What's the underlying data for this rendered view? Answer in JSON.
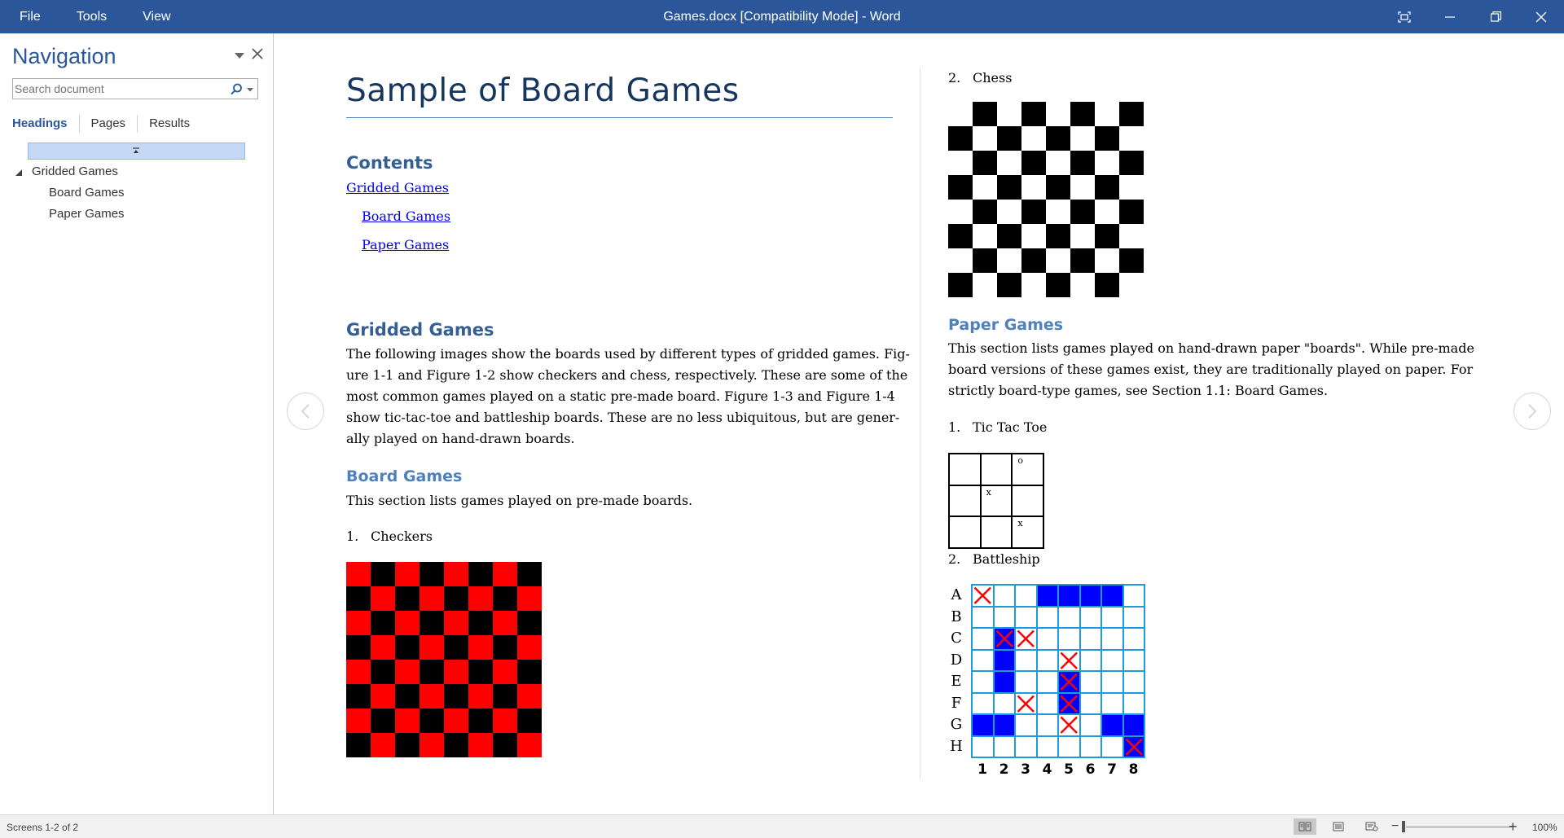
{
  "window": {
    "title": "Games.docx [Compatibility Mode] - Word",
    "menu": [
      "File",
      "Tools",
      "View"
    ]
  },
  "navigation": {
    "title": "Navigation",
    "search_placeholder": "Search document",
    "tabs": [
      "Headings",
      "Pages",
      "Results"
    ],
    "active_tab": "Headings",
    "tree": [
      {
        "label": "Gridded Games",
        "level": 1,
        "expanded": true
      },
      {
        "label": "Board Games",
        "level": 2
      },
      {
        "label": "Paper Games",
        "level": 2
      }
    ]
  },
  "document": {
    "title": "Sample of Board Games",
    "contents_heading": "Contents",
    "toc": [
      "Gridded Games",
      "Board Games",
      "Paper Games"
    ],
    "gridded_heading": "Gridded Games",
    "gridded_para": [
      "The following images show the boards used by different types of gridded games. Fig-",
      "ure 1-1 and Figure 1-2 show checkers and chess, respectively. These are some of the",
      "most common games played on a static pre-made board. Figure 1-3 and Figure 1-4",
      "show tic-tac-toe and battleship boards. These are no less ubiquitous, but are gener-",
      "ally played on hand-drawn boards."
    ],
    "board_heading": "Board Games",
    "board_para": "This section lists games played on pre-made boards.",
    "board_list": [
      {
        "num": "1.",
        "label": "Checkers"
      },
      {
        "num": "2.",
        "label": "Chess"
      }
    ],
    "paper_heading": "Paper Games",
    "paper_para": [
      "This section lists games played on hand-drawn paper \"boards\". While pre-made",
      "board versions of these games exist, they are traditionally played on paper. For",
      "strictly board-type games, see Section 1.1: Board Games."
    ],
    "paper_list": [
      {
        "num": "1.",
        "label": "Tic Tac Toe"
      },
      {
        "num": "2.",
        "label": "Battleship"
      }
    ],
    "checkers_colors": {
      "a": "#ff0000",
      "b": "#000000"
    },
    "chess_colors": {
      "a": "#ffffff",
      "b": "#000000"
    },
    "tictactoe": [
      "",
      "",
      "o",
      "",
      "x",
      "",
      "",
      "",
      "x"
    ],
    "battleship": {
      "rows": [
        "A",
        "B",
        "C",
        "D",
        "E",
        "F",
        "G",
        "H"
      ],
      "cols": [
        "1",
        "2",
        "3",
        "4",
        "5",
        "6",
        "7",
        "8"
      ],
      "ship_color": "#0000ff",
      "hit_color": "#ff0000",
      "ships": [
        "A4",
        "A5",
        "A6",
        "A7",
        "C2",
        "D2",
        "E2",
        "E5",
        "F5",
        "G1",
        "G2",
        "G7",
        "G8",
        "H8"
      ],
      "hits": [
        "A1",
        "C2",
        "C3",
        "D5",
        "E5",
        "F3",
        "F5",
        "G5",
        "H8"
      ]
    }
  },
  "status": {
    "pages": "Screens 1-2 of 2",
    "zoom": "100%"
  }
}
